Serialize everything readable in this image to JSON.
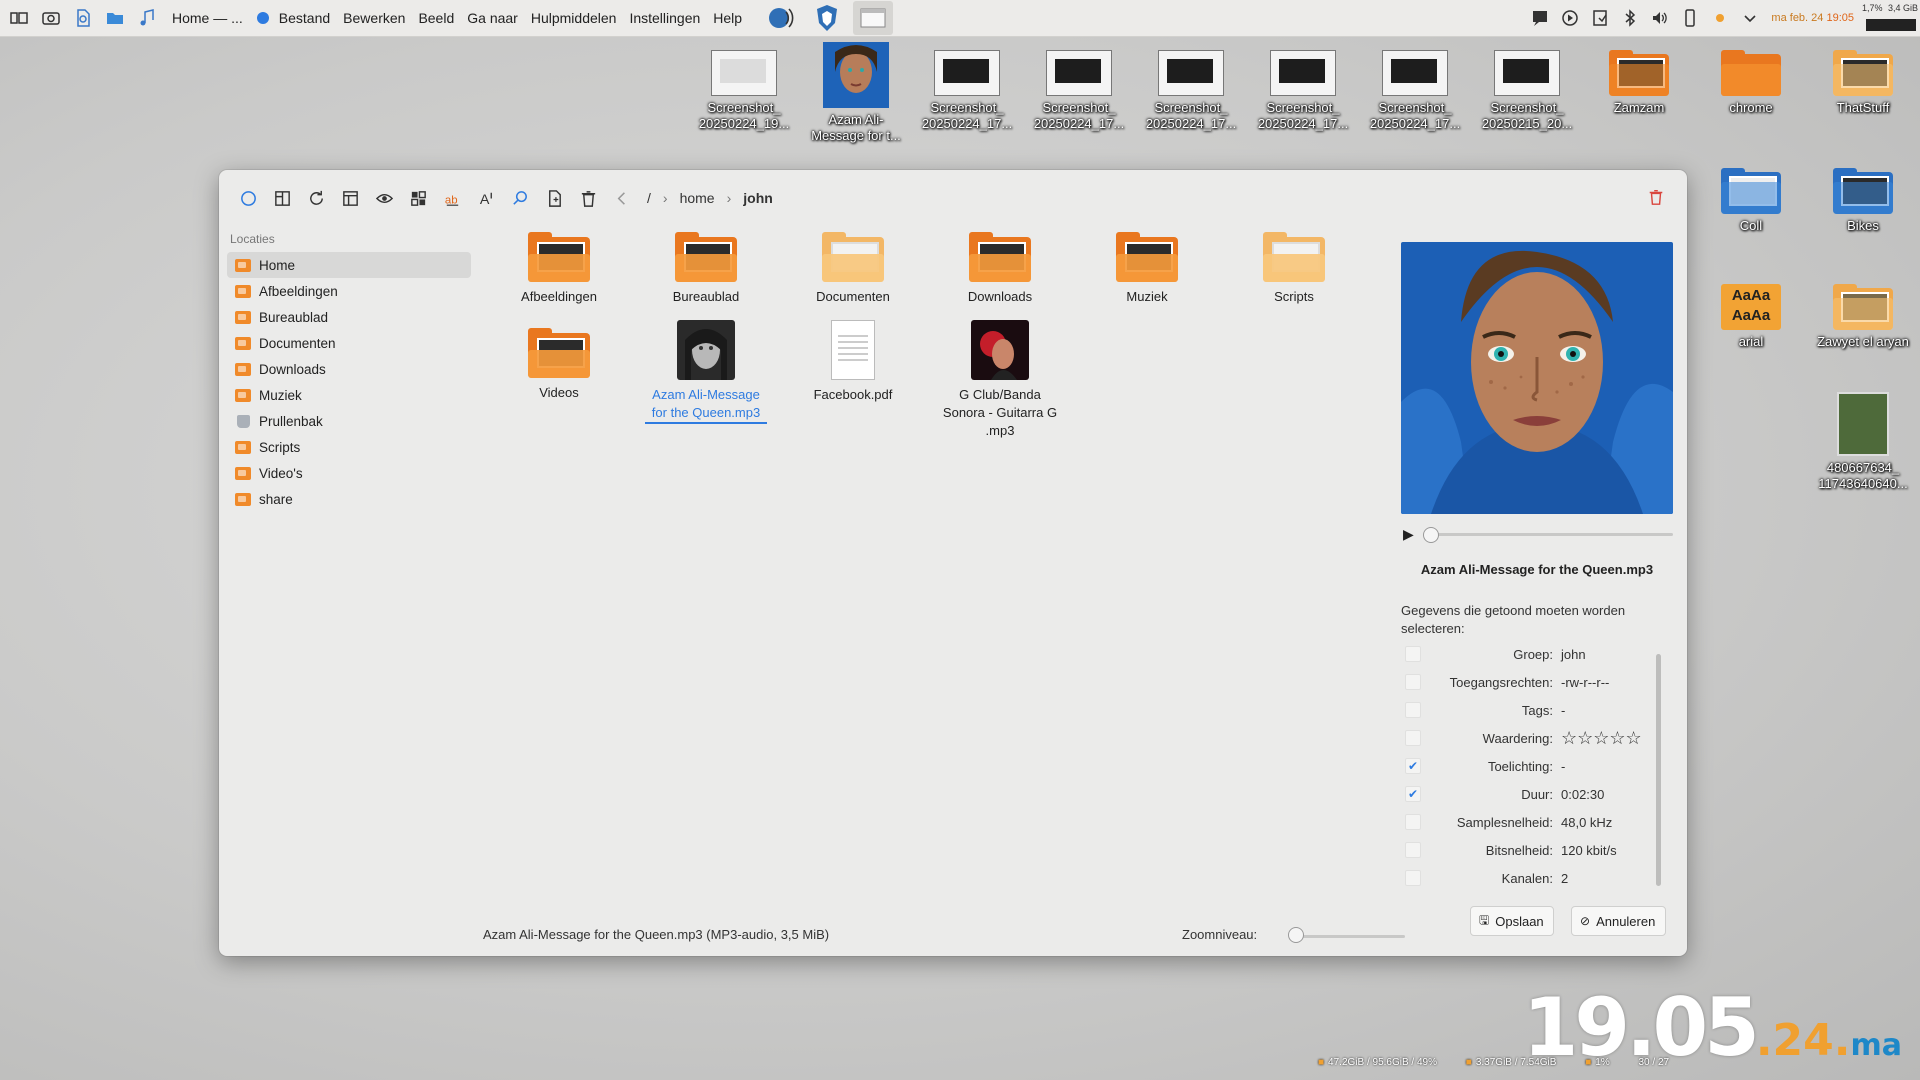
{
  "topbar": {
    "app_title": "Home — ...",
    "menu": [
      "Bestand",
      "Bewerken",
      "Beeld",
      "Ga naar",
      "Hulpmiddelen",
      "Instellingen",
      "Help"
    ],
    "clock_date": "ma feb. 24",
    "clock_time": "19:05",
    "sysmon_cpu": "1,7%",
    "sysmon_mem": "3,4 GiB"
  },
  "desktop": {
    "icons_top": [
      {
        "label1": "Screenshot_",
        "label2": "20250224_19..."
      },
      {
        "label1": "Azam Ali-",
        "label2": "Message for t..."
      },
      {
        "label1": "Screenshot_",
        "label2": "20250224_17..."
      },
      {
        "label1": "Screenshot_",
        "label2": "20250224_17..."
      },
      {
        "label1": "Screenshot_",
        "label2": "20250224_17..."
      },
      {
        "label1": "Screenshot_",
        "label2": "20250224_17..."
      },
      {
        "label1": "Screenshot_",
        "label2": "20250224_17..."
      },
      {
        "label1": "Screenshot_",
        "label2": "20250215_20..."
      },
      {
        "label1": "Zamzam",
        "label2": ""
      },
      {
        "label1": "chrome",
        "label2": ""
      },
      {
        "label1": "ThatStuff",
        "label2": ""
      }
    ],
    "icons_side": [
      {
        "label1": "Coll",
        "label2": ""
      },
      {
        "label1": "Bikes",
        "label2": ""
      },
      {
        "label1": "arial",
        "label2": ""
      },
      {
        "label1": "Zawyet el aryan",
        "label2": ""
      },
      {
        "label1": "480667634_",
        "label2": "11743640640..."
      }
    ],
    "font_preview_text": "AaAa",
    "stats": [
      "47.2GiB / 95.6GiB / 49%",
      "3.37GiB / 7.54GiB",
      "1%",
      "30 / 27"
    ],
    "big_clock": {
      "hour": "19",
      "sep": ".",
      "minute": "05",
      "day": ".24.",
      "weekday": "ma"
    }
  },
  "window": {
    "breadcrumb": {
      "root": "/",
      "home": "home",
      "current": "john"
    },
    "sidebar_header": "Locaties",
    "sidebar": [
      "Home",
      "Afbeeldingen",
      "Bureaublad",
      "Documenten",
      "Downloads",
      "Muziek",
      "Prullenbak",
      "Scripts",
      "Video's",
      "share"
    ],
    "files": [
      {
        "name": "Afbeeldingen"
      },
      {
        "name": "Bureaublad"
      },
      {
        "name": "Documenten"
      },
      {
        "name": "Downloads"
      },
      {
        "name": "Muziek"
      },
      {
        "name": "Scripts"
      },
      {
        "name": "Videos"
      },
      {
        "name": "Azam Ali-Message for the Queen.mp3"
      },
      {
        "name": "Facebook.pdf"
      },
      {
        "name": "G Club/Banda Sonora - Guitarra G .mp3"
      }
    ],
    "info": {
      "filename": "Azam Ali-Message for the Queen.mp3",
      "select_note": "Gegevens die getoond moeten worden selecteren:",
      "props": [
        {
          "key": "Groep:",
          "value": "john",
          "checked": false
        },
        {
          "key": "Toegangsrechten:",
          "value": "-rw-r--r--",
          "checked": false
        },
        {
          "key": "Tags:",
          "value": "-",
          "checked": false
        },
        {
          "key": "Waardering:",
          "value": "☆☆☆☆☆",
          "checked": false
        },
        {
          "key": "Toelichting:",
          "value": "-",
          "checked": true
        },
        {
          "key": "Duur:",
          "value": "0:02:30",
          "checked": true
        },
        {
          "key": "Samplesnelheid:",
          "value": "48,0 kHz",
          "checked": false
        },
        {
          "key": "Bitsnelheid:",
          "value": "120 kbit/s",
          "checked": false
        },
        {
          "key": "Kanalen:",
          "value": "2",
          "checked": false
        }
      ],
      "rating_stars": 0,
      "playback_position": 0,
      "save_label": "Opslaan",
      "cancel_label": "Annuleren"
    },
    "status": "Azam Ali-Message for the Queen.mp3 (MP3-audio, 3,5 MiB)",
    "zoom_label": "Zoomniveau:",
    "zoom_level": 0
  },
  "colors": {
    "accent": "#2e7be0",
    "folder": "#e9771f",
    "trash": "#d9463e",
    "clock_accent": "#f0a030"
  }
}
